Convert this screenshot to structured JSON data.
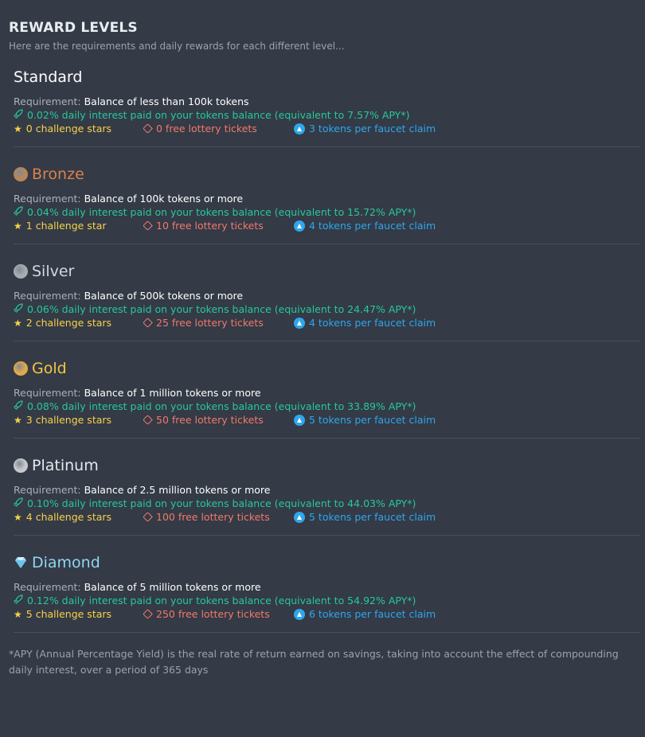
{
  "header": {
    "title": "REWARD LEVELS",
    "subtitle": "Here are the requirements and daily rewards for each different level..."
  },
  "requirement_label": "Requirement:",
  "levels": [
    {
      "name": "Standard",
      "name_color": "#ffffff",
      "medal_icon": null,
      "requirement": "Balance of less than 100k tokens",
      "interest": "0.02% daily interest paid on your tokens balance (equivalent to 7.57% APY*)",
      "stars": "0 challenge stars",
      "tickets": "0 free lottery tickets",
      "faucet": "3 tokens per faucet claim"
    },
    {
      "name": "Bronze",
      "name_color": "#d9824a",
      "medal_icon": "bronze-medal-icon",
      "medal_color": "#b98658",
      "requirement": "Balance of 100k tokens or more",
      "interest": "0.04% daily interest paid on your tokens balance (equivalent to 15.72% APY*)",
      "stars": "1 challenge star",
      "tickets": "10 free lottery tickets",
      "faucet": "4 tokens per faucet claim"
    },
    {
      "name": "Silver",
      "name_color": "#d4d8de",
      "medal_icon": "silver-medal-icon",
      "medal_color": "#a8adb4",
      "requirement": "Balance of 500k tokens or more",
      "interest": "0.06% daily interest paid on your tokens balance (equivalent to 24.47% APY*)",
      "stars": "2 challenge stars",
      "tickets": "25 free lottery tickets",
      "faucet": "4 tokens per faucet claim"
    },
    {
      "name": "Gold",
      "name_color": "#f5c542",
      "medal_icon": "gold-medal-icon",
      "medal_color": "#e0a94a",
      "requirement": "Balance of 1 million tokens or more",
      "interest": "0.08% daily interest paid on your tokens balance (equivalent to 33.89% APY*)",
      "stars": "3 challenge stars",
      "tickets": "50 free lottery tickets",
      "faucet": "5 tokens per faucet claim"
    },
    {
      "name": "Platinum",
      "name_color": "#e6e9ee",
      "medal_icon": "platinum-medal-icon",
      "medal_color": "#c5c9cf",
      "requirement": "Balance of 2.5 million tokens or more",
      "interest": "0.10% daily interest paid on your tokens balance (equivalent to 44.03% APY*)",
      "stars": "4 challenge stars",
      "tickets": "100 free lottery tickets",
      "faucet": "5 tokens per faucet claim"
    },
    {
      "name": "Diamond",
      "name_color": "#8fd6f0",
      "medal_icon": "diamond-icon",
      "medal_color": "#9fdcf5",
      "requirement": "Balance of 5 million tokens or more",
      "interest": "0.12% daily interest paid on your tokens balance (equivalent to 54.92% APY*)",
      "stars": "5 challenge stars",
      "tickets": "250 free lottery tickets",
      "faucet": "6 tokens per faucet claim"
    }
  ],
  "footnote": "*APY (Annual Percentage Yield) is the real rate of return earned on savings, taking into account the effect of compounding daily interest, over a period of 365 days"
}
